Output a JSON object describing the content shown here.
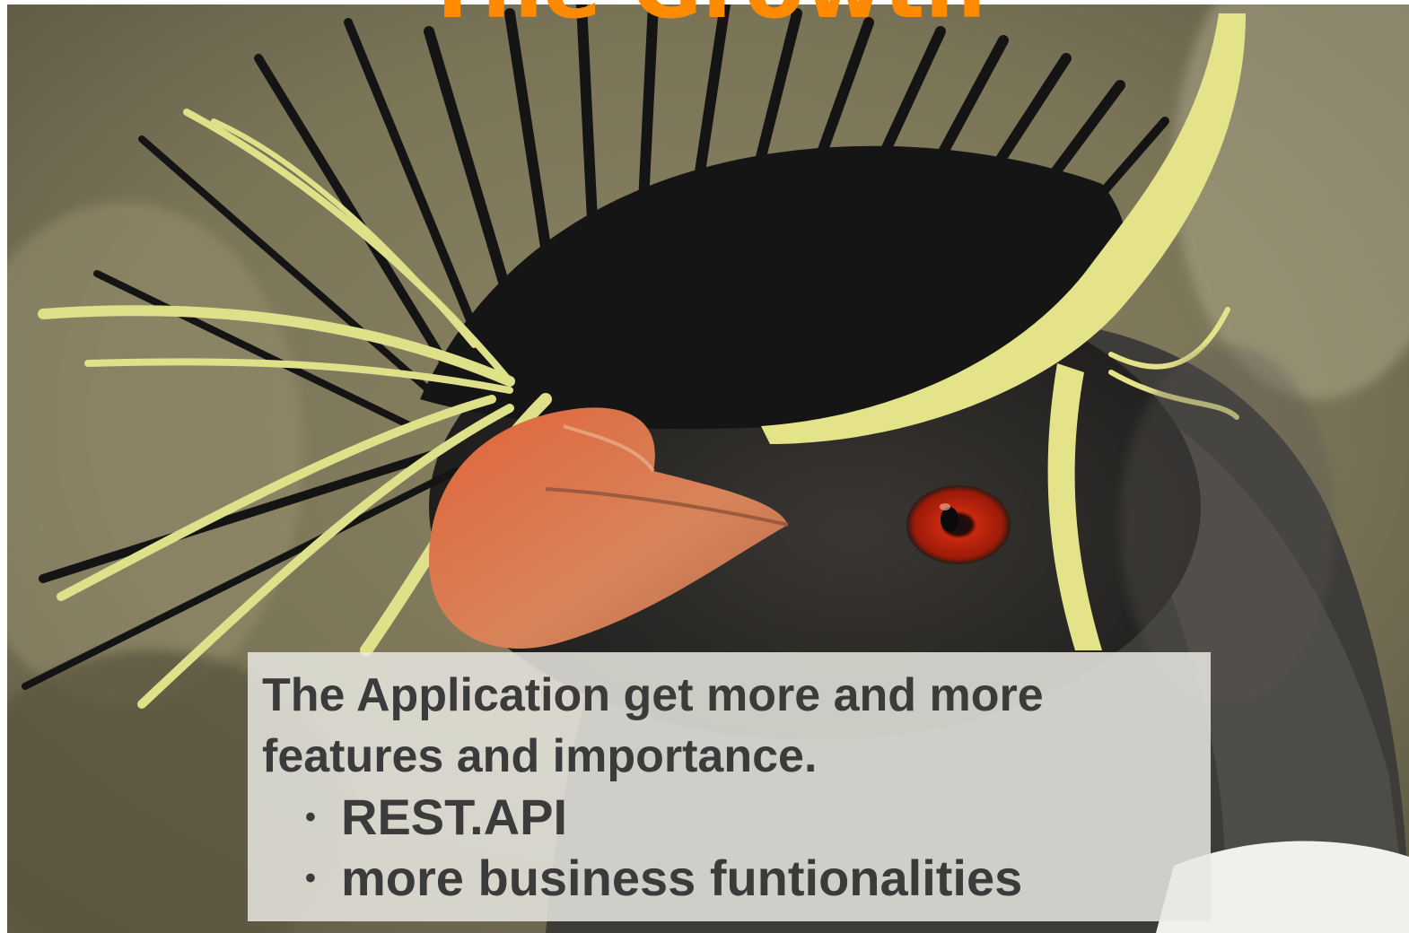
{
  "slide": {
    "title": "The Growth",
    "title_color": "#ff8a00",
    "background_image": "rockhopper-penguin-closeup",
    "text_color": "#3b3b3b",
    "intro": "The Application get more and more features and importance.",
    "bullet_glyph": "•",
    "bullets": [
      "REST.API",
      "more business funtionalities"
    ]
  }
}
